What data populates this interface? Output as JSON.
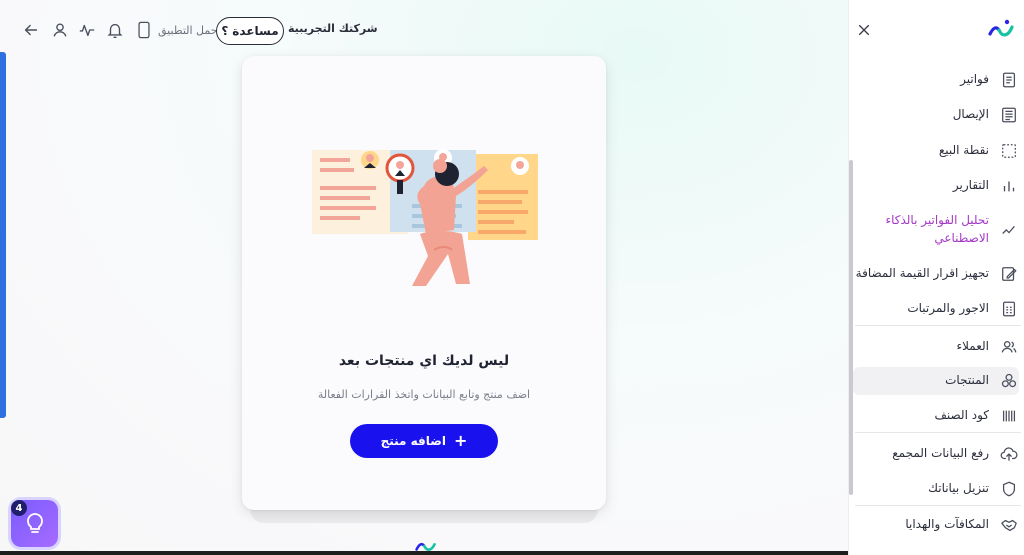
{
  "header": {
    "company_name": "شركتك التجريبية",
    "help_label": "مساعدة",
    "help_icon_glyph": "؟",
    "download_app_label": "حمل التطبيق"
  },
  "empty_state": {
    "title": "ليس لديك اي منتجات بعد",
    "subtitle": "اضف منتج وتابع البيانات واتخذ القرارات الفعالة",
    "add_button_label": "اضافه منتج",
    "add_button_icon": "+"
  },
  "assistant": {
    "badge_count": "4"
  },
  "sidebar": {
    "items": [
      {
        "label": "فواتير",
        "icon": "invoice-icon"
      },
      {
        "label": "الإيصال",
        "icon": "receipt-icon"
      },
      {
        "label": "نقطة البيع",
        "icon": "pos-icon"
      },
      {
        "label": "التقارير",
        "icon": "reports-icon"
      },
      {
        "label": "تحليل الفواتير بالذكاء الاصطناعي",
        "icon": "ai-analysis-icon"
      },
      {
        "label": "تجهيز اقرار القيمة المضافة",
        "icon": "vat-icon"
      },
      {
        "label": "الاجور والمرتبات",
        "icon": "payroll-icon"
      },
      {
        "label": "العملاء",
        "icon": "customers-icon"
      },
      {
        "label": "المنتجات",
        "icon": "products-icon"
      },
      {
        "label": "كود الصنف",
        "icon": "barcode-icon"
      },
      {
        "label": "رفع البيانات المجمع",
        "icon": "upload-icon"
      },
      {
        "label": "تنزيل بياناتك",
        "icon": "shield-icon"
      },
      {
        "label": "المكافآت والهدايا",
        "icon": "rewards-icon"
      }
    ]
  },
  "colors": {
    "primary": "#1a12ee",
    "accent_bar": "#2f6fe0",
    "ai_text": "#a338c7",
    "brand_green": "#16c2a3",
    "brand_blue": "#2a25e6"
  }
}
